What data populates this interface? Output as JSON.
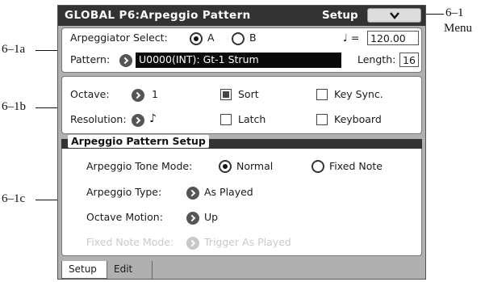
{
  "callouts": {
    "menu_num": "6–1",
    "menu_word": "Menu",
    "a": "6–1a",
    "b": "6–1b",
    "c": "6–1c"
  },
  "titlebar": {
    "title": "GLOBAL  P6:Arpeggio Pattern",
    "setup": "Setup",
    "menu_icon": "chevron-down-icon"
  },
  "arp_select": {
    "label": "Arpeggiator Select:",
    "option_a": "A",
    "option_b": "B",
    "selected": "A",
    "tempo_prefix": "♩ =",
    "tempo": "120.00"
  },
  "pattern": {
    "label": "Pattern:",
    "value": "U0000(INT): Gt-1 Strum",
    "length_label": "Length:",
    "length": "16"
  },
  "octave": {
    "label": "Octave:",
    "value": "1"
  },
  "resolution": {
    "label": "Resolution:",
    "value": "♪"
  },
  "checks": {
    "sort": {
      "label": "Sort",
      "checked": true
    },
    "key_sync": {
      "label": "Key Sync.",
      "checked": false
    },
    "latch": {
      "label": "Latch",
      "checked": false
    },
    "keyboard": {
      "label": "Keyboard",
      "checked": false
    }
  },
  "section": {
    "title": "Arpeggio Pattern Setup"
  },
  "tone_mode": {
    "label": "Arpeggio Tone Mode:",
    "normal": "Normal",
    "fixed": "Fixed Note",
    "selected": "Normal"
  },
  "arp_type": {
    "label": "Arpeggio Type:",
    "value": "As Played"
  },
  "octave_motion": {
    "label": "Octave Motion:",
    "value": "Up"
  },
  "fixed_note_mode": {
    "label": "Fixed Note Mode:",
    "value": "Trigger As Played",
    "enabled": false
  },
  "tabs": [
    {
      "label": "Setup",
      "active": true
    },
    {
      "label": "Edit",
      "active": false
    }
  ]
}
